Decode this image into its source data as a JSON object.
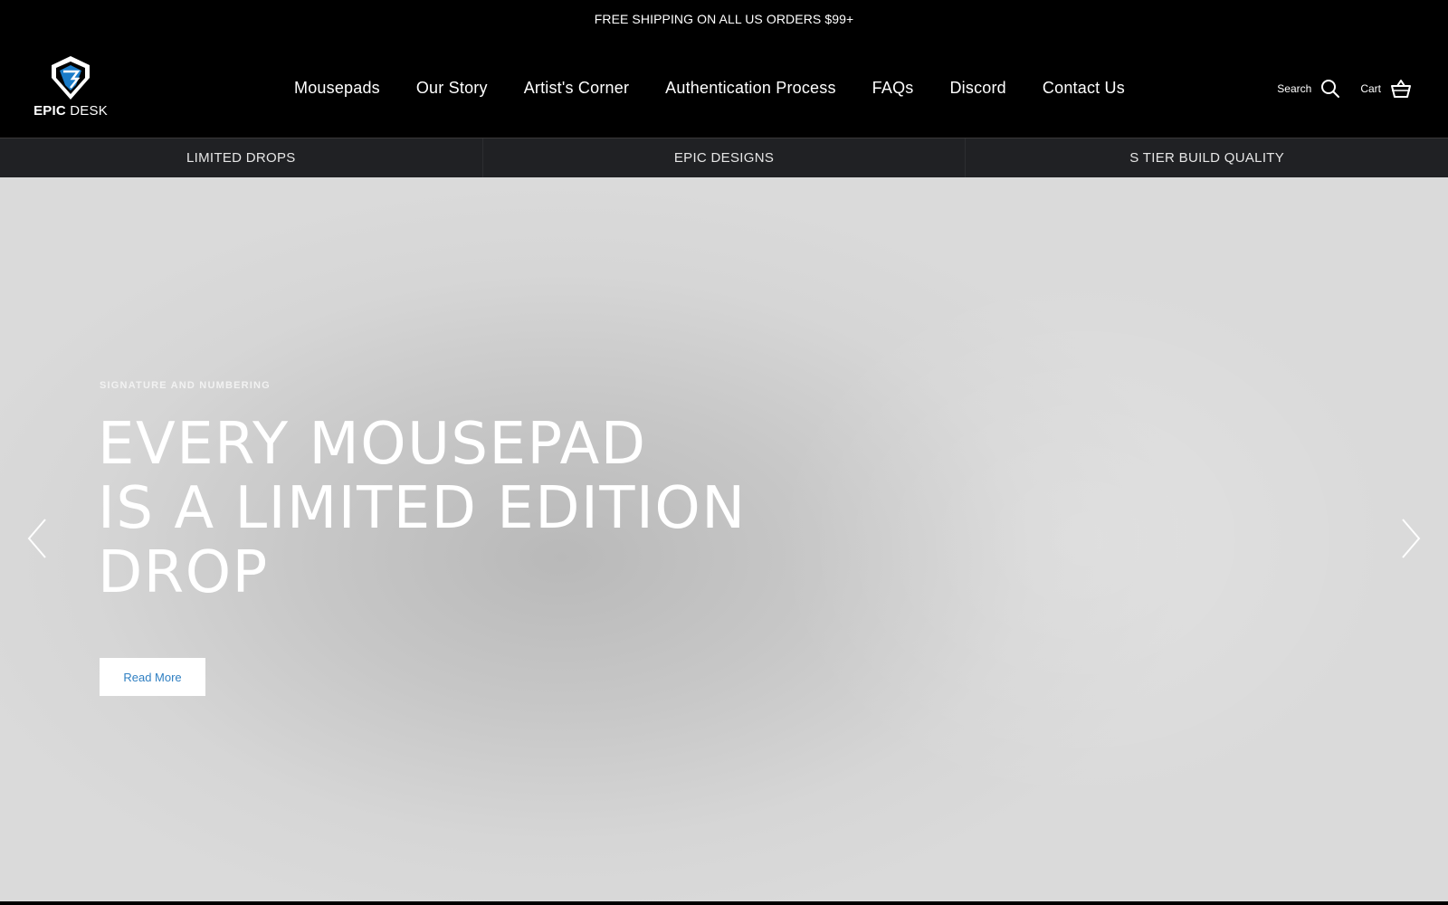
{
  "announcement": {
    "text": "FREE SHIPPING ON ALL US ORDERS $99+"
  },
  "logo": {
    "word_bold": "EPIC",
    "word_regular": "DESK",
    "icon": "epic-desk-shield-logo",
    "accent": "#1a7cc9"
  },
  "nav": {
    "items": [
      {
        "label": "Mousepads"
      },
      {
        "label": "Our Story"
      },
      {
        "label": "Artist's Corner"
      },
      {
        "label": "Authentication Process"
      },
      {
        "label": "FAQs"
      },
      {
        "label": "Discord"
      },
      {
        "label": "Contact Us"
      }
    ]
  },
  "utils": {
    "search_label": "Search",
    "search_icon": "search-icon",
    "cart_label": "Cart",
    "cart_icon": "basket-icon"
  },
  "promo": {
    "items": [
      {
        "label": "LIMITED DROPS"
      },
      {
        "label": "EPIC DESIGNS"
      },
      {
        "label": "S TIER BUILD QUALITY"
      }
    ]
  },
  "hero": {
    "eyebrow": "SIGNATURE AND NUMBERING",
    "headline_lines": [
      "EVERY MOUSEPAD",
      "IS A LIMITED EDITION",
      "DROP"
    ],
    "cta_label": "Read More",
    "prev_icon": "chevron-left-icon",
    "next_icon": "chevron-right-icon"
  },
  "colors": {
    "background": "#000000",
    "promo_bar": "#202124",
    "cta_text": "#2f7fc2"
  }
}
